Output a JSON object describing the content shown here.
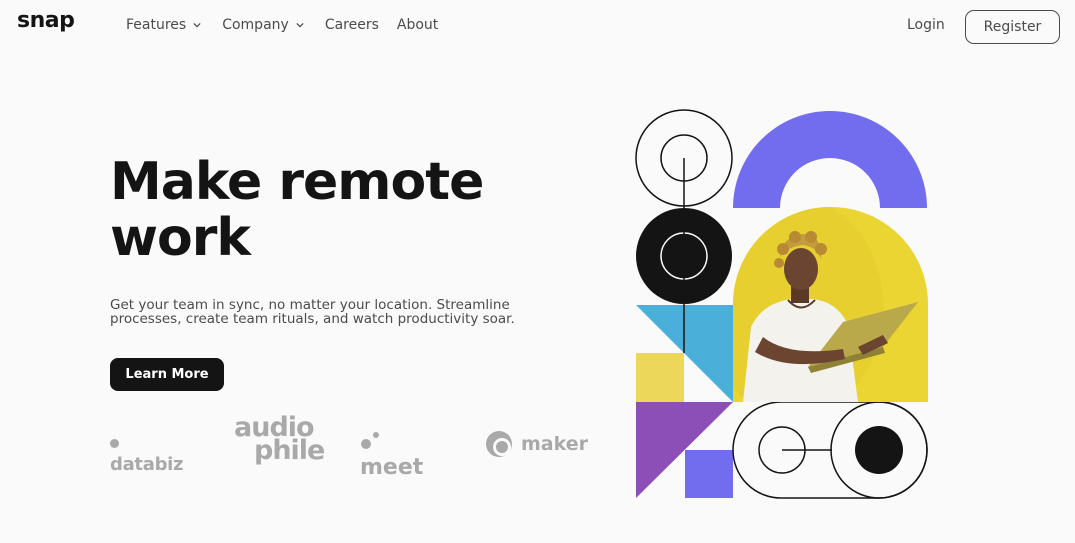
{
  "brand": {
    "logo": "snap"
  },
  "nav": {
    "items": [
      {
        "label": "Features",
        "has_dropdown": true
      },
      {
        "label": "Company",
        "has_dropdown": true
      },
      {
        "label": "Careers",
        "has_dropdown": false
      },
      {
        "label": "About",
        "has_dropdown": false
      }
    ],
    "login_label": "Login",
    "register_label": "Register"
  },
  "hero": {
    "headline_line1": "Make remote",
    "headline_line2": "work",
    "subtext_line1": "Get your team in sync, no matter your location. Streamline",
    "subtext_line2": "processes, create team rituals, and watch productivity soar.",
    "cta_label": "Learn More"
  },
  "clients": {
    "databiz": "databiz",
    "audiophile_line1": "audio",
    "audiophile_line2": "phile",
    "meet": "meet",
    "maker": "maker"
  },
  "colors": {
    "dark": "#141414",
    "gray": "#4b4b4b",
    "brand_gray": "#a9a9a9",
    "purple": "#726cee",
    "blue": "#4aafd9",
    "yellow": "#edd75a",
    "violet": "#8c4fb8",
    "photo_bg": "#ebd533"
  }
}
